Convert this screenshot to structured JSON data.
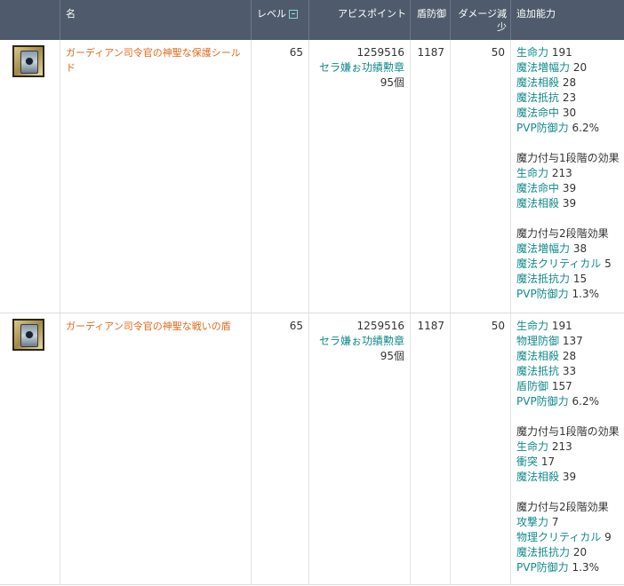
{
  "headers": {
    "name": "名",
    "level": "レベル",
    "abyss_points": "アビスポイント",
    "shield_def": "盾防御",
    "damage_reduction": "ダメージ減少",
    "bonus": "追加能力"
  },
  "items": [
    {
      "name": "ガーディアン司令官の神聖な保護シールド",
      "level": "65",
      "abyss_points": "1259516",
      "medal_name": "セラ嫌ぉ功績勲章",
      "medal_count": "95個",
      "shield_def": "1187",
      "damage_reduction": "50",
      "stats": [
        {
          "name": "生命力",
          "value": "191"
        },
        {
          "name": "魔法増幅力",
          "value": "20"
        },
        {
          "name": "魔法相殺",
          "value": "28"
        },
        {
          "name": "魔法抵抗",
          "value": "23"
        },
        {
          "name": "魔法命中",
          "value": "30"
        },
        {
          "name": "PVP防御力",
          "value": "6.2%"
        }
      ],
      "enchant1_title": "魔力付与1段階の効果",
      "enchant1": [
        {
          "name": "生命力",
          "value": "213"
        },
        {
          "name": "魔法命中",
          "value": "39"
        },
        {
          "name": "魔法相殺",
          "value": "39"
        }
      ],
      "enchant2_title": "魔力付与2段階効果",
      "enchant2": [
        {
          "name": "魔法増幅力",
          "value": "38"
        },
        {
          "name": "魔法クリティカル",
          "value": "5"
        },
        {
          "name": "魔法抵抗力",
          "value": "15"
        },
        {
          "name": "PVP防御力",
          "value": "1.3%"
        }
      ]
    },
    {
      "name": "ガーディアン司令官の神聖な戦いの盾",
      "level": "65",
      "abyss_points": "1259516",
      "medal_name": "セラ嫌ぉ功績勲章",
      "medal_count": "95個",
      "shield_def": "1187",
      "damage_reduction": "50",
      "stats": [
        {
          "name": "生命力",
          "value": "191"
        },
        {
          "name": "物理防御",
          "value": "137"
        },
        {
          "name": "魔法相殺",
          "value": "28"
        },
        {
          "name": "魔法抵抗",
          "value": "33"
        },
        {
          "name": "盾防御",
          "value": "157"
        },
        {
          "name": "PVP防御力",
          "value": "6.2%"
        }
      ],
      "enchant1_title": "魔力付与1段階の効果",
      "enchant1": [
        {
          "name": "生命力",
          "value": "213"
        },
        {
          "name": "衝突",
          "value": "17"
        },
        {
          "name": "魔法相殺",
          "value": "39"
        }
      ],
      "enchant2_title": "魔力付与2段階効果",
      "enchant2": [
        {
          "name": "攻撃力",
          "value": "7"
        },
        {
          "name": "物理クリティカル",
          "value": "9"
        },
        {
          "name": "魔法抵抗力",
          "value": "20"
        },
        {
          "name": "PVP防御力",
          "value": "1.3%"
        }
      ]
    }
  ]
}
